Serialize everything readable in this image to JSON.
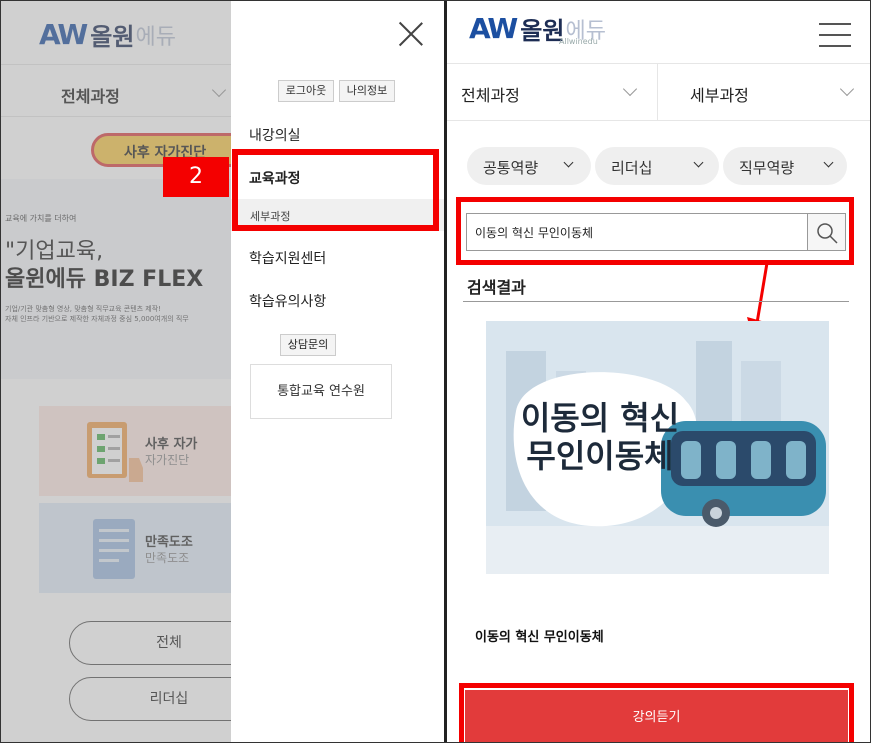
{
  "brand": {
    "logo_mark": "AW",
    "logo_text": "올원",
    "logo_edu": "에듀",
    "logo_sub": "Allwinedu"
  },
  "left": {
    "select_all": "전체과정",
    "survey_pill": "사후 자가진단",
    "hero_small": "교육에 가치를 더하여",
    "hero_line1": "\"기업교육,",
    "hero_line2": "올윈에듀 BIZ FLEX",
    "hero_desc1": "기업/기관 맞춤형 영상, 맞춤형 직무교육 콘텐츠 제작!",
    "hero_desc2": "자체 인프라 기반으로 제작한 자체과정 중심 5,000여개의 직무",
    "card1_title": "사후 자가",
    "card1_sub": "자가진단",
    "card2_title": "만족도조",
    "card2_sub": "만족도조",
    "btn_all": "전체",
    "btn_leader": "리더십"
  },
  "drawer": {
    "logout": "로그아웃",
    "myinfo": "나의정보",
    "menu": [
      "내강의실",
      "교육과정",
      "세부과정",
      "학습지원센터",
      "학습유의사항"
    ],
    "consult": "상담문의",
    "integrated": "통합교육 연수원",
    "step_badge": "2"
  },
  "right": {
    "select_all": "전체과정",
    "select_detail": "세부과정",
    "filters": [
      "공통역량",
      "리더십",
      "직무역량"
    ],
    "search_value": "이동의 혁신 무인이동체",
    "result_title": "검색결과",
    "thumb_line1": "이동의 혁신",
    "thumb_line2": "무인이동체",
    "course_name": "이동의 혁신 무인이동체",
    "lecture_button": "강의듣기"
  },
  "colors": {
    "highlight": "#f40000",
    "primary_btn": "#e23b3b",
    "logo_blue": "#1c4fa1"
  },
  "icons": [
    "close-icon",
    "hamburger-icon",
    "search-icon",
    "chevron-down-icon",
    "arrow-icon"
  ]
}
